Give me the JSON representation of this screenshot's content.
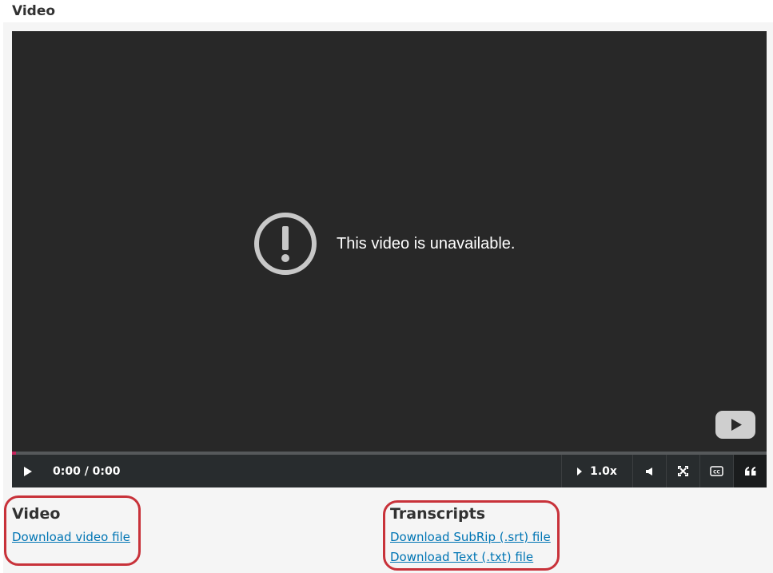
{
  "page": {
    "title": "Video"
  },
  "player": {
    "unavailable_message": "This video is unavailable.",
    "progress_percent": 0,
    "time_display": "0:00 / 0:00",
    "speed_label": "1.0x",
    "icons": {
      "alert": "alert-circle-icon",
      "youtube": "youtube-logo-icon",
      "play": "play-icon",
      "speed": "caret-right-icon",
      "volume": "volume-icon",
      "fullscreen": "fullscreen-icon",
      "captions": "cc-icon",
      "transcript": "quote-icon"
    },
    "colors": {
      "background": "#282828",
      "controls": "#282c2e",
      "progress_track": "#56595b",
      "progress_fill": "#c7255e"
    }
  },
  "downloads": {
    "video": {
      "heading": "Video",
      "link_label": "Download video file"
    },
    "transcripts": {
      "heading": "Transcripts",
      "srt_label": "Download SubRip (.srt) file",
      "txt_label": "Download Text (.txt) file"
    }
  },
  "colors": {
    "link": "#0075b4",
    "highlight": "#c8323a"
  }
}
